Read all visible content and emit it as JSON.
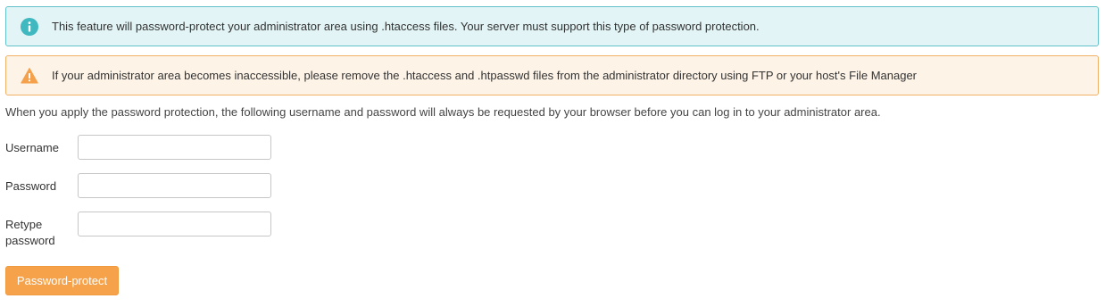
{
  "alerts": {
    "info": {
      "icon": "info-circle-icon",
      "color": "#3fb8bf",
      "text": "This feature will password-protect your administrator area using .htaccess files. Your server must support this type of password protection."
    },
    "warning": {
      "icon": "warning-triangle-icon",
      "color": "#f5a04a",
      "text": "If your administrator area becomes inaccessible, please remove the .htaccess and .htpasswd files from the administrator directory using FTP or your host's File Manager"
    }
  },
  "intro": "When you apply the password protection, the following username and password will always be requested by your browser before you can log in to your administrator area.",
  "form": {
    "username_label": "Username",
    "username_value": "",
    "password_label": "Password",
    "password_value": "",
    "retype_label_line1": "Retype",
    "retype_label_line2": "password",
    "retype_value": "",
    "submit_label": "Password-protect"
  },
  "colors": {
    "button": "#f6a24b",
    "info_bg": "#e2f4f5",
    "warning_bg": "#fdf3e7"
  }
}
